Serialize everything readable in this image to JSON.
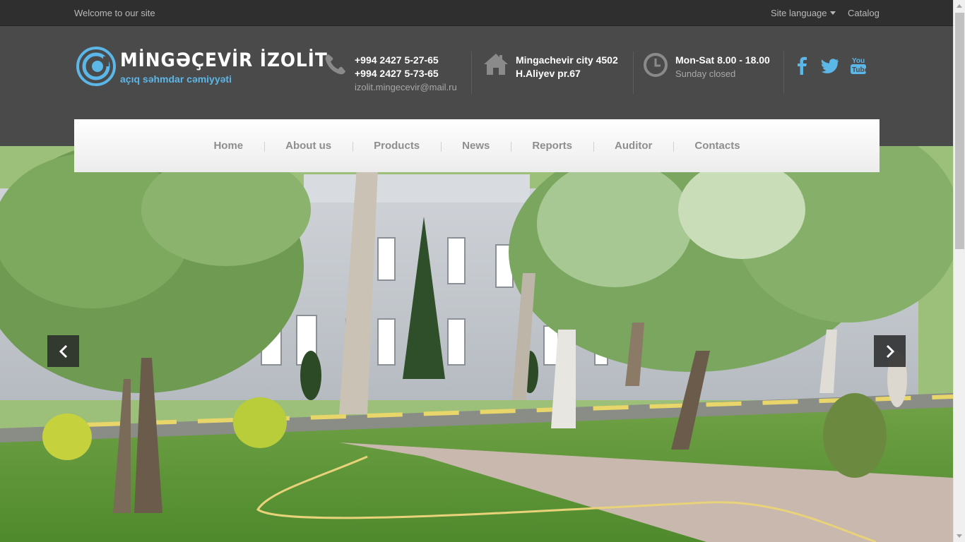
{
  "topbar": {
    "welcome": "Welcome to our site",
    "language_label": "Site language",
    "catalog_label": "Catalog"
  },
  "logo": {
    "title": "MİNGƏÇEVİR İZOLİT",
    "subtitle": "açıq səhmdar cəmiyyəti"
  },
  "contact": {
    "phone_1": "+994 2427 5-27-65",
    "phone_2": "+994 2427 5-73-65",
    "email": "izolit.mingecevir@mail.ru",
    "address_1": "Mingachevir city 4502",
    "address_2": "H.Aliyev pr.67",
    "hours": "Mon-Sat 8.00 - 18.00",
    "hours_note": "Sunday closed"
  },
  "social": [
    "facebook-icon",
    "twitter-icon",
    "youtube-icon"
  ],
  "nav": {
    "items": [
      "Home",
      "About us",
      "Products",
      "News",
      "Reports",
      "Auditor",
      "Contacts"
    ]
  },
  "slider": {
    "prev_icon": "chevron-left-icon",
    "next_icon": "chevron-right-icon"
  },
  "colors": {
    "topbar_bg": "#2f2f2f",
    "header_bg": "#4a4a4a",
    "accent": "#5bb7e8",
    "nav_text": "#8e8e8e"
  }
}
